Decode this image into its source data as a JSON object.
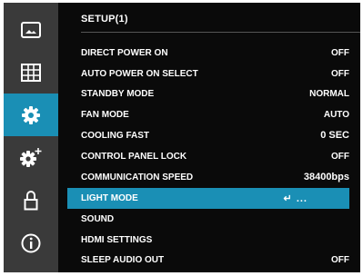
{
  "menu": {
    "title": "SETUP(1)",
    "items": [
      {
        "label": "DIRECT POWER ON",
        "value": "OFF"
      },
      {
        "label": "AUTO POWER ON SELECT",
        "value": "OFF"
      },
      {
        "label": "STANDBY MODE",
        "value": "NORMAL"
      },
      {
        "label": "FAN MODE",
        "value": "AUTO"
      },
      {
        "label": "COOLING FAST",
        "value": "0 SEC"
      },
      {
        "label": "CONTROL PANEL LOCK",
        "value": "OFF"
      },
      {
        "label": "COMMUNICATION SPEED",
        "value": "38400bps"
      },
      {
        "label": "LIGHT MODE",
        "value": "↵ ..."
      },
      {
        "label": "SOUND",
        "value": ""
      },
      {
        "label": "HDMI SETTINGS",
        "value": ""
      },
      {
        "label": "SLEEP AUDIO OUT",
        "value": "OFF"
      }
    ],
    "selected_index": 7
  },
  "sidebar": {
    "items": [
      {
        "icon": "picture-icon"
      },
      {
        "icon": "display-grid-icon"
      },
      {
        "icon": "gear-icon"
      },
      {
        "icon": "gear-plus-icon"
      },
      {
        "icon": "lock-icon"
      },
      {
        "icon": "info-icon"
      }
    ],
    "selected_index": 2
  },
  "colors": {
    "accent": "#1a8fb5",
    "background": "#0a0a0a",
    "sidebar": "#3a3a3a",
    "text": "#ffffff"
  }
}
